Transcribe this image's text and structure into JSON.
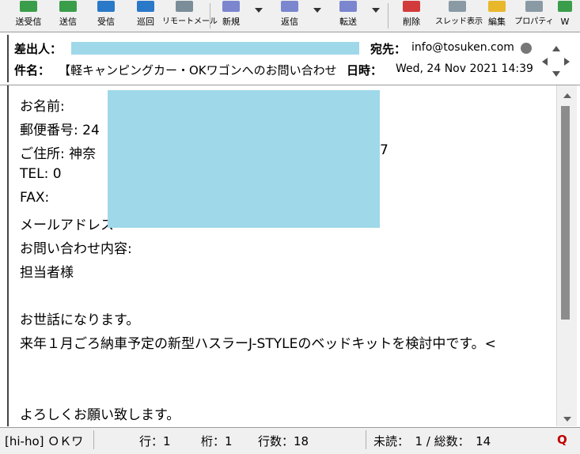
{
  "toolbar": {
    "buttons": [
      {
        "label": "送受信",
        "icon": "send-receive-icon",
        "color": "#2e7d32"
      },
      {
        "label": "送信",
        "icon": "send-icon",
        "color": "#2e7d32"
      },
      {
        "label": "受信",
        "icon": "receive-icon",
        "color": "#1565c0"
      },
      {
        "label": "巡回",
        "icon": "patrol-icon",
        "color": "#1565c0"
      },
      {
        "label": "リモートメール",
        "icon": "remote-mail-icon",
        "color": "#607d8b"
      },
      {
        "label": "新規",
        "icon": "new-mail-icon",
        "color": "#5c6bc0"
      },
      {
        "label": "返信",
        "icon": "reply-icon",
        "color": "#5c6bc0"
      },
      {
        "label": "転送",
        "icon": "forward-icon",
        "color": "#5c6bc0"
      },
      {
        "label": "削除",
        "icon": "delete-icon",
        "color": "#c62828"
      },
      {
        "label": "スレッド表示",
        "icon": "thread-view-icon",
        "color": "#546e7a"
      },
      {
        "label": "編集",
        "icon": "edit-icon",
        "color": "#f9a825"
      },
      {
        "label": "プロパティ",
        "icon": "properties-icon",
        "color": "#546e7a"
      },
      {
        "label": "W",
        "icon": "extra-icon",
        "color": "#2e7d32"
      }
    ]
  },
  "header": {
    "from_label": "差出人：",
    "to_label": "宛先：",
    "to_value": "info@tosuken.com",
    "subject_label": "件名：",
    "subject_value": "【軽キャンピングカー・OKワゴンへのお問い合わせ",
    "date_label": "日時：",
    "date_value": "Wed, 24 Nov 2021 14:39"
  },
  "body": {
    "lines": [
      "お名前:",
      "郵便番号: 24",
      "ご住所: 神奈",
      "TEL:        0",
      "FAX:",
      "メールアドレス",
      "お問い合わせ内容:",
      "担当者様",
      "",
      "お世話になります。",
      "来年１月ごろ納車予定の新型ハスラーJ-STYLEのベッドキットを検討中です。<",
      "",
      "",
      "よろしくお願い致します。"
    ],
    "address_tail": "7",
    "wrap_marker": "<"
  },
  "status": {
    "account": "[hi-ho] ＯＫワ",
    "row": "行：1",
    "col": "桁：1",
    "lines": "行数：18",
    "unread": "未読：　1 / 総数：　14",
    "q_icon": "Q"
  },
  "colors": {
    "redaction": "#9fd8e9",
    "link": "#1a3fc4",
    "q_icon": "#c00000"
  }
}
